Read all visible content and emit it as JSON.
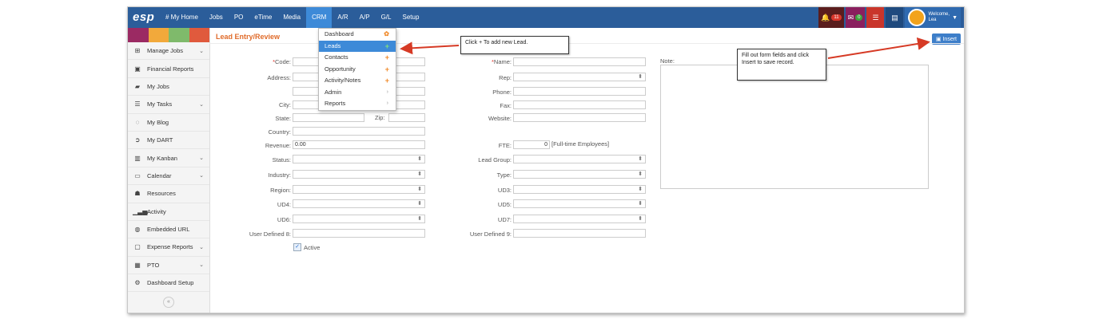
{
  "app": {
    "logo": "esp"
  },
  "nav": {
    "items": [
      "# My Home",
      "Jobs",
      "PO",
      "eTime",
      "Media",
      "CRM",
      "A/R",
      "A/P",
      "G/L",
      "Setup"
    ],
    "active": "CRM"
  },
  "topbar": {
    "notifications_count": "11",
    "messages_count": "0",
    "welcome_line1": "Welcome,",
    "welcome_line2": "Lea"
  },
  "sidebar": {
    "swatch_colors": [
      "#9b2a63",
      "#f2a93b",
      "#7fba6b",
      "#e05a3d"
    ],
    "items": [
      {
        "label": "Manage Jobs",
        "icon": "sitemap-icon",
        "chevron": true
      },
      {
        "label": "Financial Reports",
        "icon": "report-icon",
        "chevron": false
      },
      {
        "label": "My Jobs",
        "icon": "folder-icon",
        "chevron": false
      },
      {
        "label": "My Tasks",
        "icon": "tasks-icon",
        "chevron": true
      },
      {
        "label": "My Blog",
        "icon": "comment-icon",
        "chevron": false
      },
      {
        "label": "My DART",
        "icon": "arrow-circle-icon",
        "chevron": false
      },
      {
        "label": "My Kanban",
        "icon": "kanban-icon",
        "chevron": true
      },
      {
        "label": "Calendar",
        "icon": "calendar-icon",
        "chevron": true
      },
      {
        "label": "Resources",
        "icon": "users-icon",
        "chevron": false
      },
      {
        "label": "Activity",
        "icon": "bar-chart-icon",
        "chevron": false
      },
      {
        "label": "Embedded URL",
        "icon": "globe-icon",
        "chevron": false
      },
      {
        "label": "Expense Reports",
        "icon": "money-icon",
        "chevron": true
      },
      {
        "label": "PTO",
        "icon": "calendar-grid-icon",
        "chevron": true
      },
      {
        "label": "Dashboard Setup",
        "icon": "cogs-icon",
        "chevron": false
      }
    ]
  },
  "page": {
    "title": "Lead Entry/Review",
    "insert_label": "Insert",
    "note_label": "Note:"
  },
  "form": {
    "code_label": "Code:",
    "address_label": "Address:",
    "city_label": "City:",
    "state_label": "State:",
    "zip_label": "Zip:",
    "country_label": "Country:",
    "revenue_label": "Revenue:",
    "revenue_value": "0.00",
    "status_label": "Status:",
    "industry_label": "Industry:",
    "region_label": "Region:",
    "ud4_label": "UD4:",
    "ud6_label": "UD6:",
    "ud8_label": "User Defined 8:",
    "active_label": "Active",
    "name_label": "Name:",
    "rep_label": "Rep:",
    "phone_label": "Phone:",
    "fax_label": "Fax:",
    "website_label": "Website:",
    "fte_label": "FTE:",
    "fte_value": "0",
    "fte_hint": "[Full-time Employees]",
    "lead_group_label": "Lead Group:",
    "type_label": "Type:",
    "ud3_label": "UD3:",
    "ud5_label": "UD5:",
    "ud7_label": "UD7:",
    "ud9_label": "User Defined 9:"
  },
  "crm_menu": {
    "items": [
      "Dashboard",
      "Leads",
      "Contacts",
      "Opportunity",
      "Activity/Notes",
      "Admin",
      "Reports"
    ],
    "highlighted": "Leads"
  },
  "callouts": {
    "leads": "Click + To add new Lead.",
    "insert": "Fill out form fields and click Insert to save record."
  }
}
